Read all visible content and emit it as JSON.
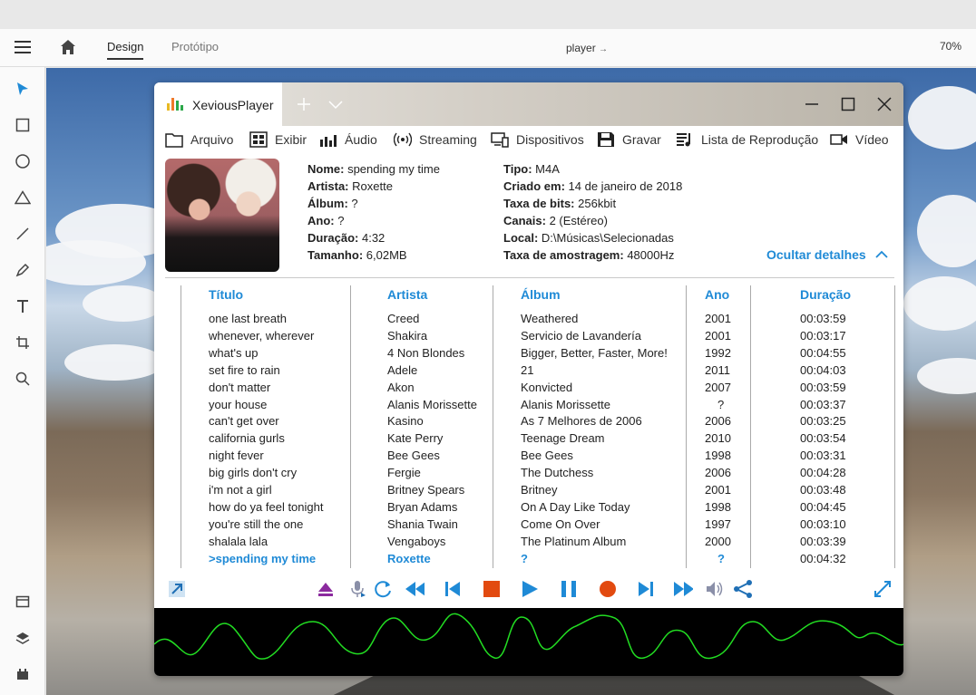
{
  "app": {
    "tabs": [
      "Design",
      "Protótipo"
    ],
    "document_title": "player",
    "zoom": "70%"
  },
  "player": {
    "title": "XeviousPlayer",
    "menu": [
      "Arquivo",
      "Exibir",
      "Áudio",
      "Streaming",
      "Dispositivos",
      "Gravar",
      "Lista de Reprodução",
      "Vídeo"
    ],
    "details": {
      "left": [
        {
          "label": "Nome:",
          "value": "spending my time"
        },
        {
          "label": "Artista:",
          "value": "Roxette"
        },
        {
          "label": "Álbum:",
          "value": "?"
        },
        {
          "label": "Ano:",
          "value": "?"
        },
        {
          "label": "Duração:",
          "value": "4:32"
        },
        {
          "label": "Tamanho:",
          "value": "6,02MB"
        }
      ],
      "right": [
        {
          "label": "Tipo:",
          "value": "M4A"
        },
        {
          "label": "Criado em:",
          "value": "14 de janeiro de 2018"
        },
        {
          "label": "Taxa de bits:",
          "value": "256kbit"
        },
        {
          "label": "Canais:",
          "value": "2 (Estéreo)"
        },
        {
          "label": "Local:",
          "value": "D:\\Músicas\\Selecionadas"
        },
        {
          "label": "Taxa de amostragem:",
          "value": "48000Hz"
        }
      ],
      "hide_label": "Ocultar detalhes"
    },
    "table": {
      "headers": [
        "Título",
        "Artista",
        "Álbum",
        "Ano",
        "Duração"
      ],
      "rows": [
        [
          "one last breath",
          "Creed",
          "Weathered",
          "2001",
          "00:03:59"
        ],
        [
          "whenever, wherever",
          "Shakira",
          "Servicio de Lavandería",
          "2001",
          "00:03:17"
        ],
        [
          "what's up",
          "4 Non Blondes",
          "Bigger, Better, Faster, More!",
          "1992",
          "00:04:55"
        ],
        [
          "set fire to rain",
          "Adele",
          "21",
          "2011",
          "00:04:03"
        ],
        [
          "don't matter",
          "Akon",
          "Konvicted",
          "2007",
          "00:03:59"
        ],
        [
          "your house",
          "Alanis Morissette",
          "Alanis Morissette",
          "?",
          "00:03:37"
        ],
        [
          "can't get over",
          "Kasino",
          "As 7 Melhores de 2006",
          "2006",
          "00:03:25"
        ],
        [
          "california gurls",
          "Kate Perry",
          "Teenage Dream",
          "2010",
          "00:03:54"
        ],
        [
          "night fever",
          "Bee Gees",
          "Bee Gees",
          "1998",
          "00:03:31"
        ],
        [
          "big girls don't cry",
          "Fergie",
          "The Dutchess",
          "2006",
          "00:04:28"
        ],
        [
          "i'm not a girl",
          "Britney Spears",
          "Britney",
          "2001",
          "00:03:48"
        ],
        [
          "how do ya feel tonight",
          "Bryan Adams",
          "On A Day Like Today",
          "1998",
          "00:04:45"
        ],
        [
          "you're still the one",
          "Shania Twain",
          "Come On Over",
          "1997",
          "00:03:10"
        ],
        [
          "shalala lala",
          "Vengaboys",
          "The Platinum Album",
          "2000",
          "00:03:39"
        ],
        [
          ">spending my time",
          "Roxette",
          "?",
          "?",
          "00:04:32"
        ]
      ],
      "active_row": 14
    },
    "colors": {
      "accent": "#1f8ad6",
      "wave": "#22dd22",
      "record": "#e24a10"
    }
  }
}
